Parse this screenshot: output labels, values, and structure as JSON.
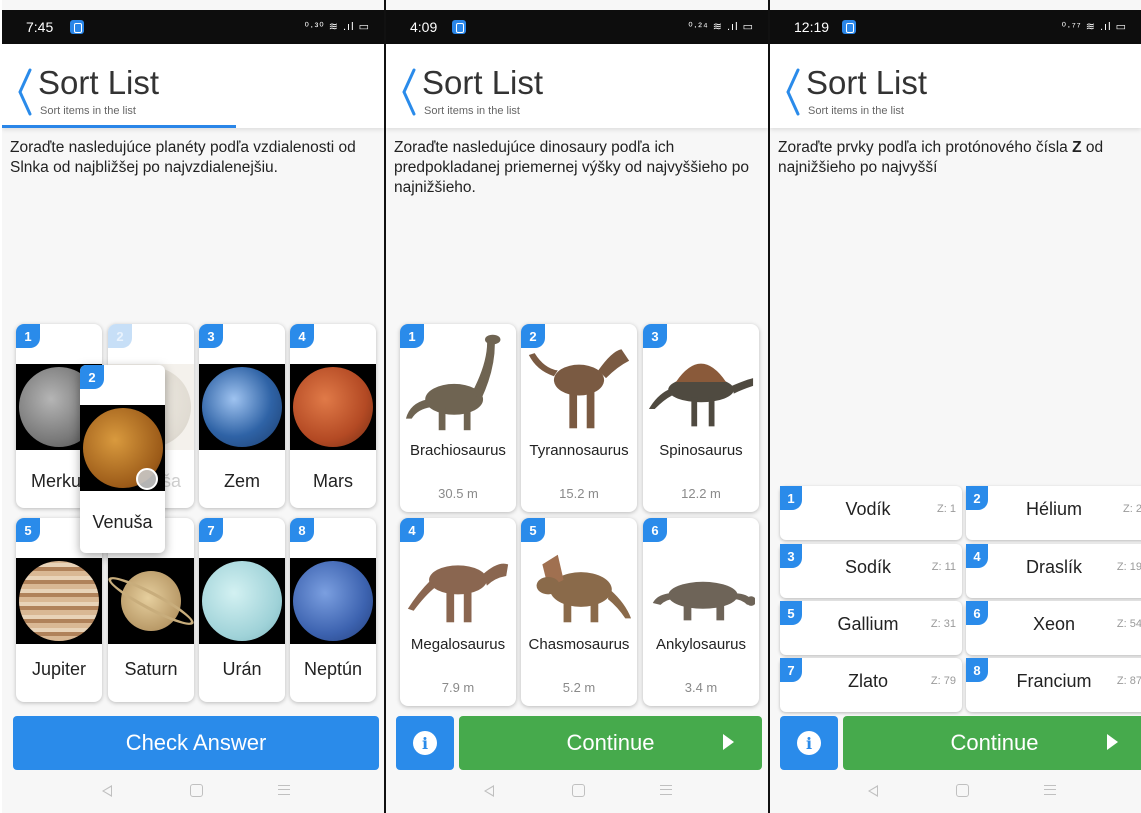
{
  "screens": [
    {
      "status": {
        "time": "7:45",
        "right": "⁰·³⁰ ≋ .ıl ▭"
      },
      "header": {
        "title": "Sort List",
        "subtitle": "Sort items in the list",
        "progress": 0.6
      },
      "question": "Zoraďte nasledujúce planéty podľa vzdialenosti od Slnka od najbližšej po najvzdialenejšiu.",
      "items": [
        {
          "num": "1",
          "label": "Merkur",
          "color": "#8d8d8d"
        },
        {
          "num": "2",
          "label": "Venuša",
          "color": "#c9c2b4"
        },
        {
          "num": "3",
          "label": "Zem",
          "color": "#3b73b8"
        },
        {
          "num": "4",
          "label": "Mars",
          "color": "#c4542e"
        },
        {
          "num": "5",
          "label": "Jupiter",
          "color": "#c39a73"
        },
        {
          "num": "6",
          "label": "Saturn",
          "color": "#c8ad7c"
        },
        {
          "num": "7",
          "label": "Urán",
          "color": "#a9d8dd"
        },
        {
          "num": "8",
          "label": "Neptún",
          "color": "#3f66b4"
        }
      ],
      "dragging": {
        "num": "2",
        "label": "Venuša",
        "color": "#c77f2a"
      },
      "button": "Check Answer"
    },
    {
      "status": {
        "time": "4:09",
        "right": "⁰·²⁴ ≋ .ıl ▭"
      },
      "header": {
        "title": "Sort List",
        "subtitle": "Sort items in the list"
      },
      "question": "Zoraďte nasledujúce dinosaury podľa ich predpokladanej priemernej výšky od najvyššieho po najnižšieho.",
      "items": [
        {
          "num": "1",
          "label": "Brachiosaurus",
          "value": "30.5 m",
          "color": "#6f6452"
        },
        {
          "num": "2",
          "label": "Tyrannosaurus",
          "value": "15.2 m",
          "color": "#7a5a42"
        },
        {
          "num": "3",
          "label": "Spinosaurus",
          "value": "12.2 m",
          "color": "#4f4a40"
        },
        {
          "num": "4",
          "label": "Megalosaurus",
          "value": "7.9 m",
          "color": "#8a6650"
        },
        {
          "num": "5",
          "label": "Chasmosaurus",
          "value": "5.2 m",
          "color": "#8a6a4a"
        },
        {
          "num": "6",
          "label": "Ankylosaurus",
          "value": "3.4 m",
          "color": "#6e6458"
        }
      ],
      "button": "Continue"
    },
    {
      "status": {
        "time": "12:19",
        "right": "⁰·⁷⁷ ≋ .ıl ▭"
      },
      "header": {
        "title": "Sort List",
        "subtitle": "Sort items in the list"
      },
      "question_pre": "Zoraďte prvky podľa ich protónového čísla ",
      "question_bold": "Z",
      "question_post": " od najnižšieho po najvyšší",
      "items": [
        {
          "num": "1",
          "label": "Vodík",
          "z": "Z: 1"
        },
        {
          "num": "2",
          "label": "Hélium",
          "z": "Z: 2"
        },
        {
          "num": "3",
          "label": "Sodík",
          "z": "Z: 11"
        },
        {
          "num": "4",
          "label": "Draslík",
          "z": "Z: 19"
        },
        {
          "num": "5",
          "label": "Gallium",
          "z": "Z: 31"
        },
        {
          "num": "6",
          "label": "Xeon",
          "z": "Z: 54"
        },
        {
          "num": "7",
          "label": "Zlato",
          "z": "Z: 79"
        },
        {
          "num": "8",
          "label": "Francium",
          "z": "Z: 87"
        }
      ],
      "button": "Continue"
    }
  ],
  "colors": {
    "accent": "#2a8bea",
    "continue": "#46aa4c"
  }
}
